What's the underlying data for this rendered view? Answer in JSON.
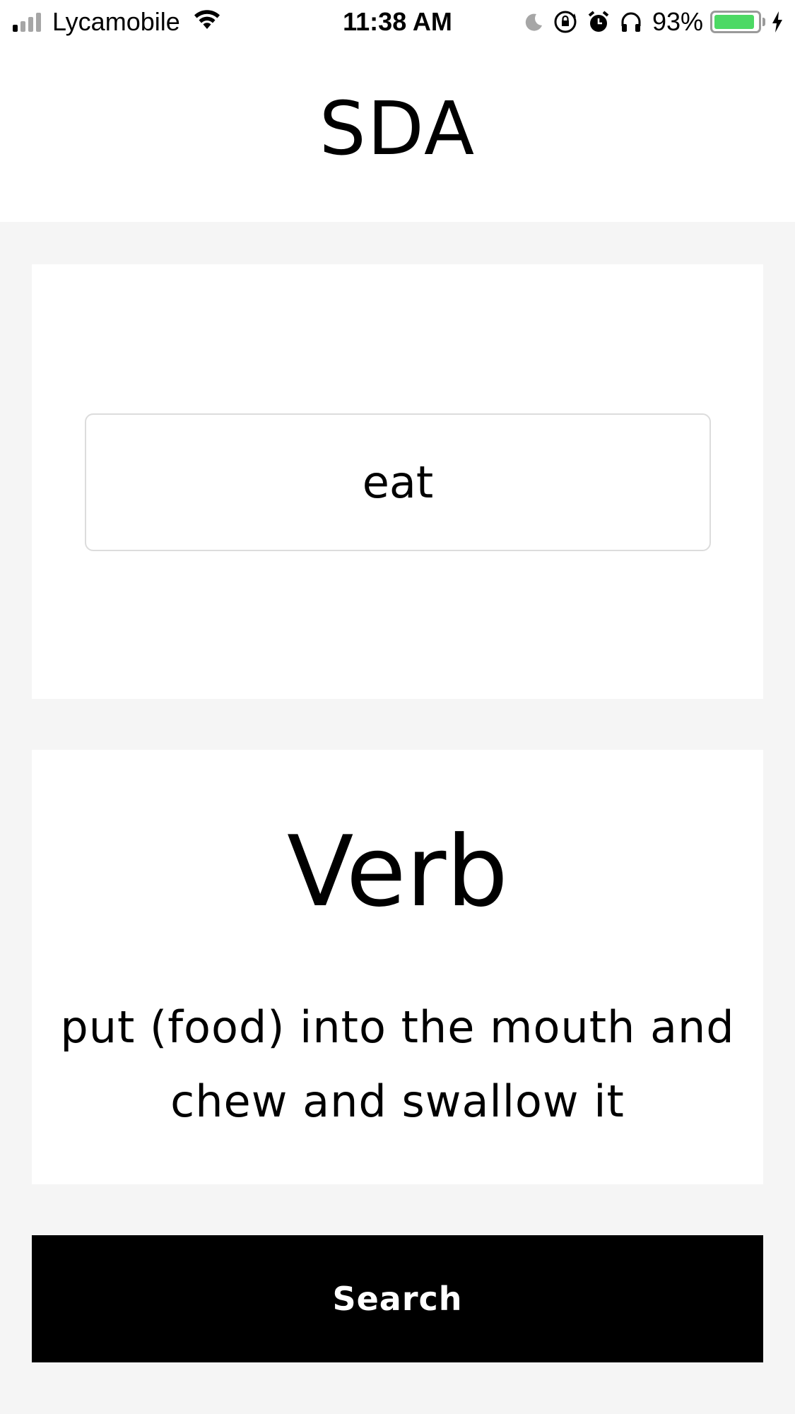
{
  "status_bar": {
    "carrier": "Lycamobile",
    "time": "11:38 AM",
    "battery_percent": "93%",
    "battery_level": 0.93,
    "signal_bars_active": 1,
    "signal_bars_total": 4,
    "icons": [
      "signal-icon",
      "wifi-icon",
      "moon-icon",
      "rotation-lock-icon",
      "alarm-icon",
      "headphones-icon",
      "battery-icon",
      "charging-bolt-icon"
    ],
    "battery_color": "#4cd964"
  },
  "header": {
    "title": "SDA"
  },
  "input_card": {
    "word_value": "eat"
  },
  "result_card": {
    "part_of_speech": "Verb",
    "definition": "put (food) into the mouth and chew and swallow it"
  },
  "actions": {
    "search_label": "Search"
  },
  "colors": {
    "background": "#f5f5f5",
    "card": "#ffffff",
    "button": "#000000",
    "button_text": "#ffffff"
  }
}
